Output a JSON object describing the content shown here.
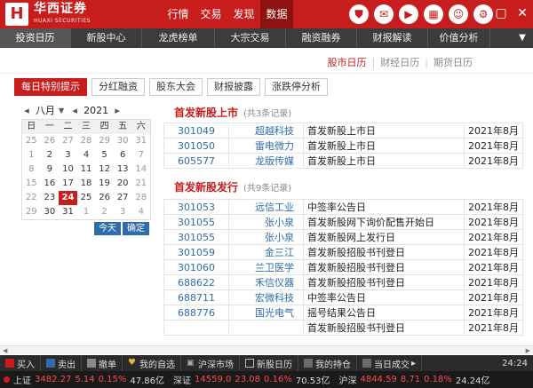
{
  "titlebar": {
    "logo_char": "H",
    "brand_cn": "华西证券",
    "brand_en": "HUAXI SECURITIES",
    "nav": [
      "行情",
      "交易",
      "发现",
      "数据"
    ],
    "active_nav": "数据"
  },
  "tabs": [
    "投资日历",
    "新股中心",
    "龙虎榜单",
    "大宗交易",
    "融资融券",
    "财报解读",
    "价值分析"
  ],
  "active_tab": "投资日历",
  "calendar_switch": [
    "股市日历",
    "财经日历",
    "期货日历"
  ],
  "filters": [
    "每日特别提示",
    "分红融资",
    "股东大会",
    "财报披露",
    "涨跌停分析"
  ],
  "calendar": {
    "month": "八月",
    "year": "2021",
    "weekdays": [
      "日",
      "一",
      "二",
      "三",
      "四",
      "五",
      "六"
    ],
    "weeks": [
      [
        "25",
        "26",
        "27",
        "28",
        "29",
        "30",
        "31"
      ],
      [
        "1",
        "2",
        "3",
        "4",
        "5",
        "6",
        "7"
      ],
      [
        "8",
        "9",
        "10",
        "11",
        "12",
        "13",
        "14"
      ],
      [
        "15",
        "16",
        "17",
        "18",
        "19",
        "20",
        "21"
      ],
      [
        "22",
        "23",
        "24",
        "25",
        "26",
        "27",
        "28"
      ],
      [
        "29",
        "30",
        "31",
        "1",
        "2",
        "3",
        "4"
      ]
    ],
    "today_label": "今天",
    "confirm_label": "确定"
  },
  "sections": [
    {
      "title": "首发新股上市",
      "count": "(共3条记录)",
      "rows": [
        {
          "code": "301049",
          "name": "超越科技",
          "event": "首发新股上市日",
          "date": "2021年8月"
        },
        {
          "code": "301050",
          "name": "雷电微力",
          "event": "首发新股上市日",
          "date": "2021年8月"
        },
        {
          "code": "605577",
          "name": "龙版传媒",
          "event": "首发新股上市日",
          "date": "2021年8月"
        }
      ]
    },
    {
      "title": "首发新股发行",
      "count": "(共9条记录)",
      "rows": [
        {
          "code": "301053",
          "name": "远信工业",
          "event": "中签率公告日",
          "date": "2021年8月"
        },
        {
          "code": "301055",
          "name": "张小泉",
          "event": "首发新股网下询价配售开始日",
          "date": "2021年8月"
        },
        {
          "code": "301055",
          "name": "张小泉",
          "event": "首发新股网上发行日",
          "date": "2021年8月"
        },
        {
          "code": "301059",
          "name": "金三江",
          "event": "首发新股招股书刊登日",
          "date": "2021年8月"
        },
        {
          "code": "301060",
          "name": "兰卫医学",
          "event": "首发新股招股书刊登日",
          "date": "2021年8月"
        },
        {
          "code": "688622",
          "name": "禾信仪器",
          "event": "首发新股招股书刊登日",
          "date": "2021年8月"
        },
        {
          "code": "688711",
          "name": "宏微科技",
          "event": "中签率公告日",
          "date": "2021年8月"
        },
        {
          "code": "688776",
          "name": "国光电气",
          "event": "摇号结果公告日",
          "date": "2021年8月"
        },
        {
          "code": "",
          "name": "",
          "event": "首发新股招股书刊登日",
          "date": "2021年8月"
        }
      ]
    }
  ],
  "funcbar": [
    "买入",
    "卖出",
    "撤单",
    "我的自选",
    "沪深市场",
    "新股日历",
    "我的持仓",
    "当日成交"
  ],
  "time": "24:24",
  "indices": [
    {
      "name": "上证",
      "value": "3482.27",
      "change": "5.14",
      "pct": "0.15%",
      "volume": "47.86亿"
    },
    {
      "name": "深证",
      "value": "14559.0",
      "change": "23.08",
      "pct": "0.16%",
      "volume": "70.53亿"
    },
    {
      "name": "沪深",
      "value": "4844.59",
      "change": "8.71",
      "pct": "0.18%",
      "volume": "24.24亿"
    }
  ]
}
